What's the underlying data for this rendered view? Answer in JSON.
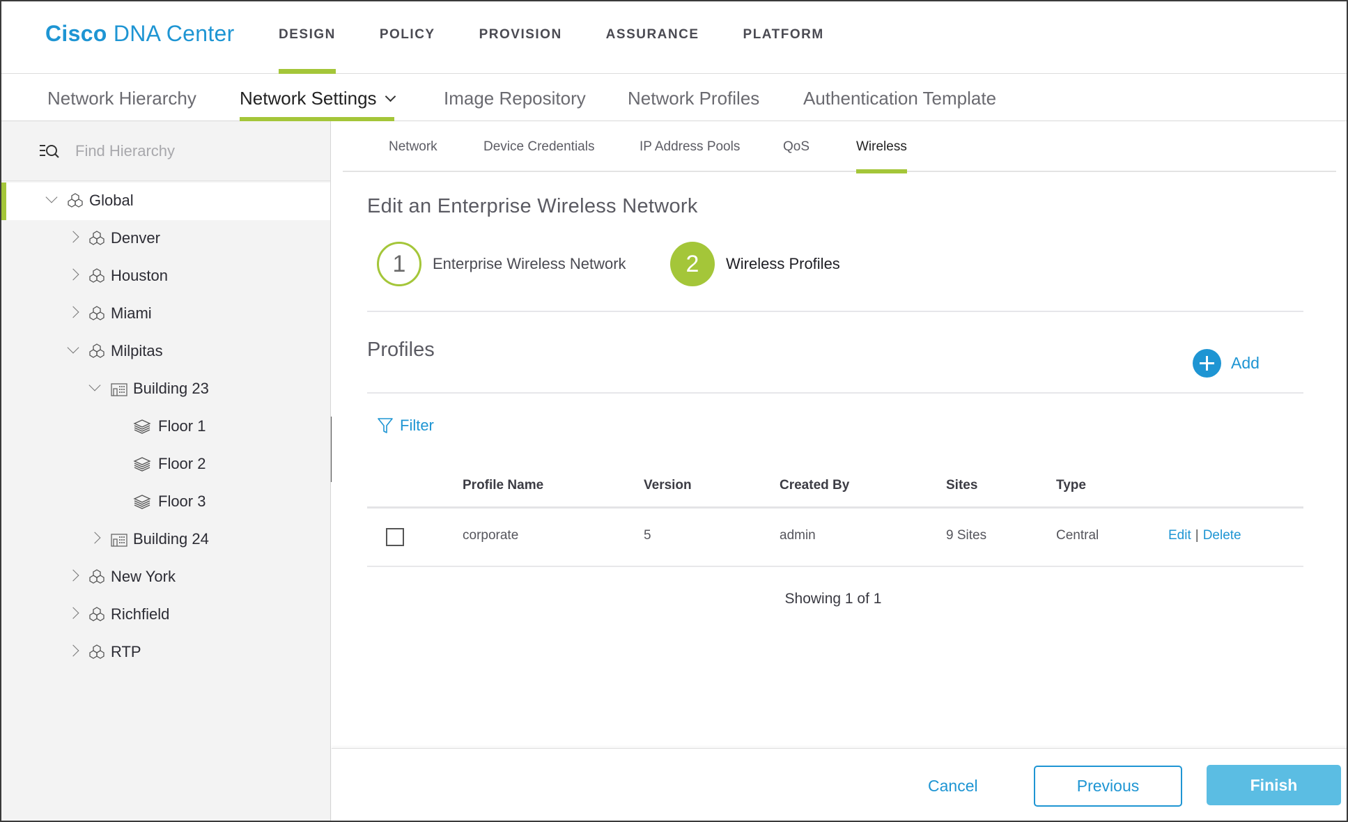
{
  "app": {
    "brand_bold": "Cisco",
    "brand_rest": " DNA Center"
  },
  "main_nav": [
    {
      "label": "DESIGN",
      "active": true
    },
    {
      "label": "POLICY",
      "active": false
    },
    {
      "label": "PROVISION",
      "active": false
    },
    {
      "label": "ASSURANCE",
      "active": false
    },
    {
      "label": "PLATFORM",
      "active": false
    }
  ],
  "header_icons": [
    "cloud-status-icon",
    "search-icon",
    "apps-grid-icon",
    "gear-icon",
    "help-lifebuoy-icon",
    "notifications-list-icon"
  ],
  "colors": {
    "accent_green": "#a4c639",
    "brand_blue": "#1e95d3",
    "status_ok": "#5cb85c",
    "notification_dot": "#0a5c8a",
    "finish_button": "#5bbde3"
  },
  "sub_nav": [
    {
      "label": "Network Hierarchy",
      "active": false
    },
    {
      "label": "Network Settings",
      "active": true,
      "has_dropdown": true
    },
    {
      "label": "Image Repository",
      "active": false
    },
    {
      "label": "Network Profiles",
      "active": false
    },
    {
      "label": "Authentication Template",
      "active": false
    }
  ],
  "sidebar": {
    "search_placeholder": "Find Hierarchy",
    "tree": [
      {
        "label": "Global",
        "type": "area",
        "level": 0,
        "expanded": true,
        "selected": true
      },
      {
        "label": "Denver",
        "type": "area",
        "level": 1,
        "expanded": false
      },
      {
        "label": "Houston",
        "type": "area",
        "level": 1,
        "expanded": false
      },
      {
        "label": "Miami",
        "type": "area",
        "level": 1,
        "expanded": false
      },
      {
        "label": "Milpitas",
        "type": "area",
        "level": 1,
        "expanded": true
      },
      {
        "label": "Building 23",
        "type": "building",
        "level": 2,
        "expanded": true
      },
      {
        "label": "Floor 1",
        "type": "floor",
        "level": 3
      },
      {
        "label": "Floor 2",
        "type": "floor",
        "level": 3
      },
      {
        "label": "Floor 3",
        "type": "floor",
        "level": 3
      },
      {
        "label": "Building 24",
        "type": "building",
        "level": 2,
        "expanded": false
      },
      {
        "label": "New York",
        "type": "area",
        "level": 1,
        "expanded": false
      },
      {
        "label": "Richfield",
        "type": "area",
        "level": 1,
        "expanded": false
      },
      {
        "label": "RTP",
        "type": "area",
        "level": 1,
        "expanded": false
      }
    ]
  },
  "tabs": [
    {
      "label": "Network",
      "active": false
    },
    {
      "label": "Device Credentials",
      "active": false
    },
    {
      "label": "IP Address Pools",
      "active": false
    },
    {
      "label": "QoS",
      "active": false
    },
    {
      "label": "Wireless",
      "active": true
    }
  ],
  "content": {
    "title": "Edit an Enterprise Wireless Network",
    "steps": [
      {
        "number": "1",
        "label": "Enterprise Wireless Network",
        "current": false
      },
      {
        "number": "2",
        "label": "Wireless Profiles",
        "current": true
      }
    ],
    "profiles_title": "Profiles",
    "add_label": "Add",
    "filter_label": "Filter",
    "table": {
      "columns": [
        "Profile Name",
        "Version",
        "Created By",
        "Sites",
        "Type"
      ],
      "rows": [
        {
          "checked": false,
          "cells": [
            "corporate",
            "5",
            "admin",
            "9 Sites",
            "Central"
          ],
          "edit_label": "Edit",
          "separator": "|",
          "delete_label": "Delete"
        }
      ]
    },
    "showing": "Showing 1 of 1"
  },
  "footer": {
    "cancel_label": "Cancel",
    "previous_label": "Previous",
    "finish_label": "Finish"
  }
}
